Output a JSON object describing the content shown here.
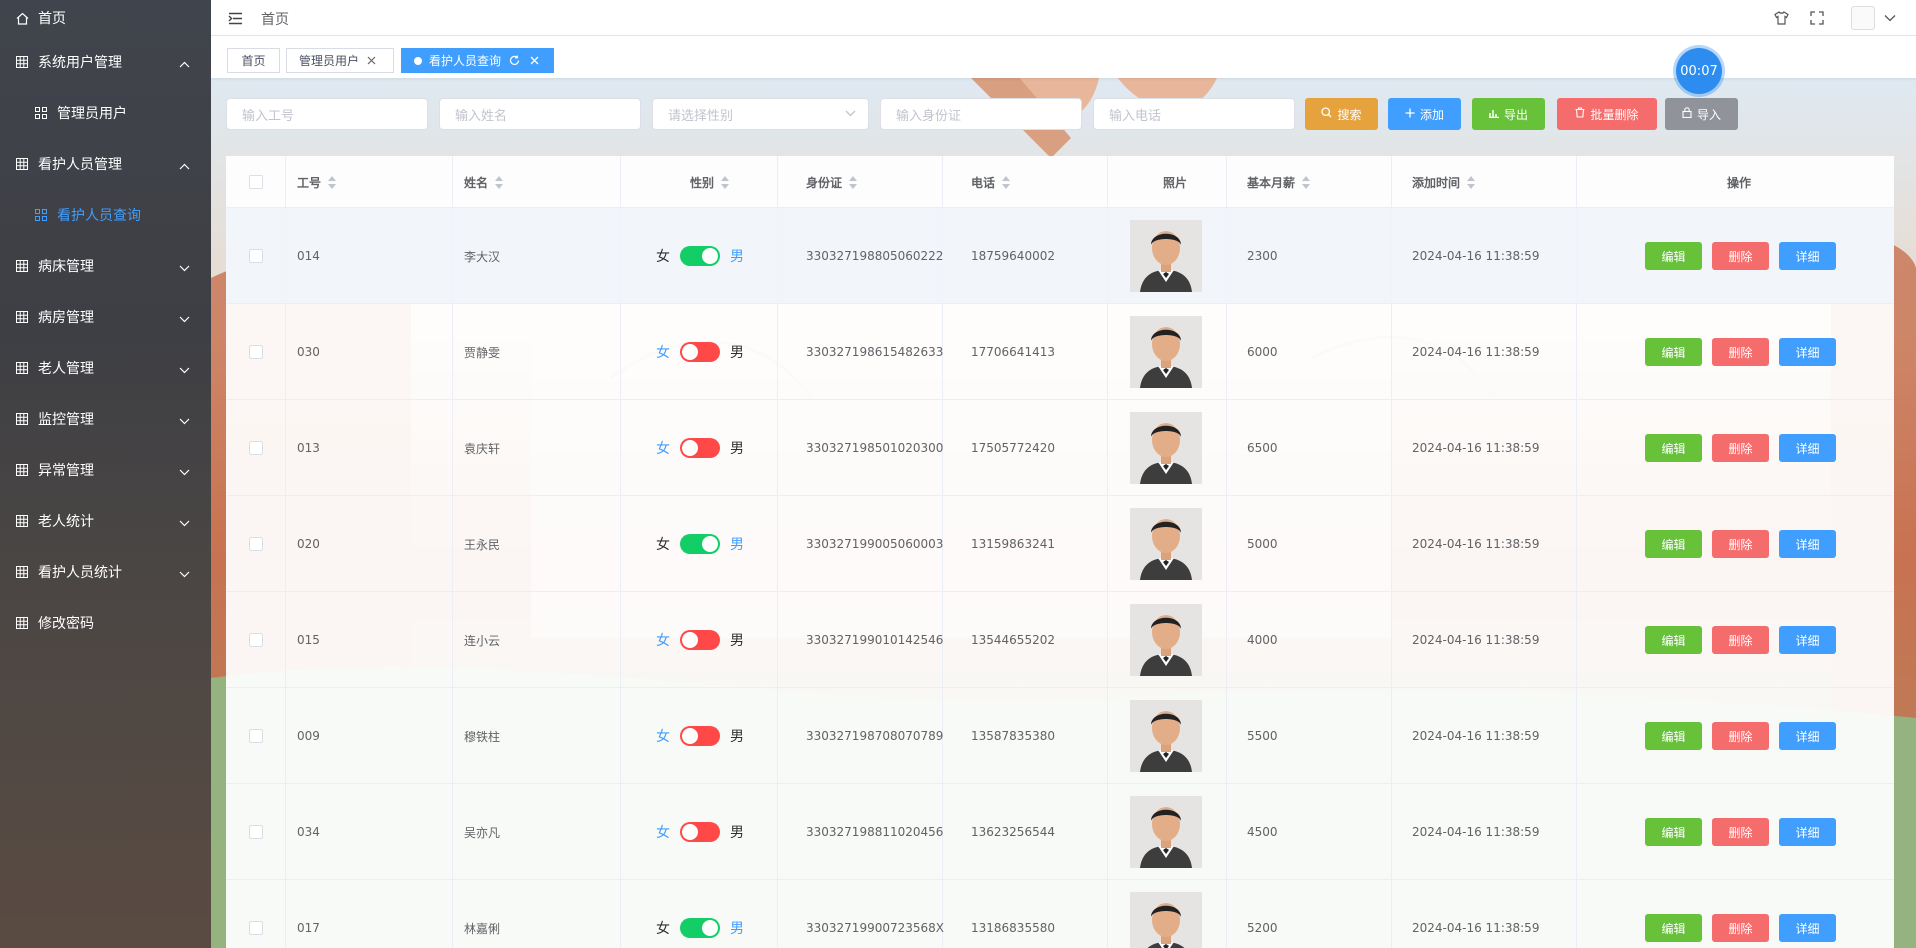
{
  "sidebar": {
    "items": [
      {
        "label": "首页",
        "icon": "home-icon",
        "type": "top"
      },
      {
        "label": "系统用户管理",
        "icon": "grid-icon",
        "expanded": true
      },
      {
        "label": "管理员用户",
        "icon": "apps-icon",
        "sub": true
      },
      {
        "label": "看护人员管理",
        "icon": "grid-icon",
        "expanded": true
      },
      {
        "label": "看护人员查询",
        "icon": "apps-icon",
        "sub": true,
        "active": true
      },
      {
        "label": "病床管理",
        "icon": "grid-icon"
      },
      {
        "label": "病房管理",
        "icon": "grid-icon"
      },
      {
        "label": "老人管理",
        "icon": "grid-icon"
      },
      {
        "label": "监控管理",
        "icon": "grid-icon"
      },
      {
        "label": "异常管理",
        "icon": "grid-icon"
      },
      {
        "label": "老人统计",
        "icon": "grid-icon"
      },
      {
        "label": "看护人员统计",
        "icon": "grid-icon"
      },
      {
        "label": "修改密码",
        "icon": "grid-icon"
      }
    ]
  },
  "header": {
    "breadcrumb": "首页",
    "icons": [
      "menu-fold-icon",
      "shirt-icon",
      "fullscreen-icon",
      "avatar",
      "chevron-down-icon"
    ]
  },
  "tags": [
    {
      "label": "首页"
    },
    {
      "label": "管理员用户"
    },
    {
      "label": "看护人员查询",
      "active": true
    }
  ],
  "timer": "00:07",
  "filters": {
    "work_no": "输入工号",
    "name": "输入姓名",
    "gender": "请选择性别",
    "id_card": "输入身份证",
    "phone": "输入电话"
  },
  "buttons": {
    "search": "搜索",
    "add": "添加",
    "export": "导出",
    "batch_delete": "批量删除",
    "import": "导入"
  },
  "colors": {
    "primary": "#409eff",
    "success": "#67c23a",
    "danger": "#f56c6c",
    "warning": "#e6a23c",
    "info": "#909399",
    "switch_on": "#13ce66",
    "switch_off": "#ff4949"
  },
  "table": {
    "headers": {
      "work_no": "工号",
      "name": "姓名",
      "gender": "性别",
      "id_card": "身份证",
      "phone": "电话",
      "photo": "照片",
      "salary": "基本月薪",
      "time": "添加时间",
      "ops": "操作"
    },
    "gender_labels": {
      "female": "女",
      "male": "男"
    },
    "op_labels": {
      "edit": "编辑",
      "delete": "删除",
      "detail": "详细"
    },
    "rows": [
      {
        "work_no": "014",
        "name": "李大汉",
        "gender": "女",
        "id_card": "330327198805060222",
        "phone": "18759640002",
        "salary": "2300",
        "time": "2024-04-16 11:38:59"
      },
      {
        "work_no": "030",
        "name": "贾静雯",
        "gender": "男",
        "id_card": "330327198615482633",
        "phone": "17706641413",
        "salary": "6000",
        "time": "2024-04-16 11:38:59"
      },
      {
        "work_no": "013",
        "name": "袁庆轩",
        "gender": "男",
        "id_card": "330327198501020300",
        "phone": "17505772420",
        "salary": "6500",
        "time": "2024-04-16 11:38:59"
      },
      {
        "work_no": "020",
        "name": "王永民",
        "gender": "女",
        "id_card": "330327199005060003",
        "phone": "13159863241",
        "salary": "5000",
        "time": "2024-04-16 11:38:59"
      },
      {
        "work_no": "015",
        "name": "连小云",
        "gender": "男",
        "id_card": "330327199010142546",
        "phone": "13544655202",
        "salary": "4000",
        "time": "2024-04-16 11:38:59"
      },
      {
        "work_no": "009",
        "name": "穆铁柱",
        "gender": "男",
        "id_card": "330327198708070789",
        "phone": "13587835380",
        "salary": "5500",
        "time": "2024-04-16 11:38:59"
      },
      {
        "work_no": "034",
        "name": "吴亦凡",
        "gender": "男",
        "id_card": "330327198811020456",
        "phone": "13623256544",
        "salary": "4500",
        "time": "2024-04-16 11:38:59"
      },
      {
        "work_no": "017",
        "name": "林嘉俐",
        "gender": "女",
        "id_card": "33032719900723568X",
        "phone": "13186835580",
        "salary": "5200",
        "time": "2024-04-16 11:38:59"
      }
    ]
  }
}
